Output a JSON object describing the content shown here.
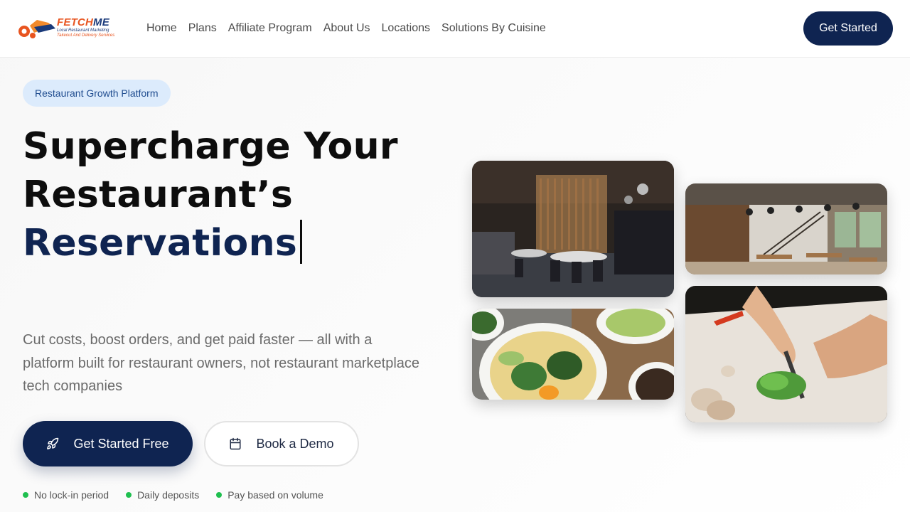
{
  "brand": {
    "name_part1": "FETCH",
    "name_part2": "ME",
    "tagline1": "Local Restaurant Marketing",
    "tagline2": "Takeout And Delivery Services"
  },
  "nav": {
    "items": [
      {
        "label": "Home"
      },
      {
        "label": "Plans"
      },
      {
        "label": "Affiliate Program"
      },
      {
        "label": "About Us"
      },
      {
        "label": "Locations"
      },
      {
        "label": "Solutions By Cuisine"
      }
    ],
    "cta_label": "Get Started"
  },
  "hero": {
    "badge": "Restaurant Growth Platform",
    "headline_line1": "Supercharge Your",
    "headline_line2": "Restaurant’s",
    "headline_accent": "Reservations",
    "subtext": "Cut costs, boost orders, and get paid faster — all with a platform built for restaurant owners, not restaurant marketplace tech companies",
    "primary_button": "Get Started Free",
    "secondary_button": "Book a Demo",
    "features": [
      {
        "label": "No lock-in period"
      },
      {
        "label": "Daily deposits"
      },
      {
        "label": "Pay based on volume"
      }
    ]
  },
  "colors": {
    "navy": "#0f2451",
    "orange": "#e8541f",
    "badge_bg": "#dcebfc",
    "feature_dot": "#1fbf4f"
  },
  "icons": {
    "primary_button_icon": "rocket-icon",
    "secondary_button_icon": "calendar-icon"
  }
}
